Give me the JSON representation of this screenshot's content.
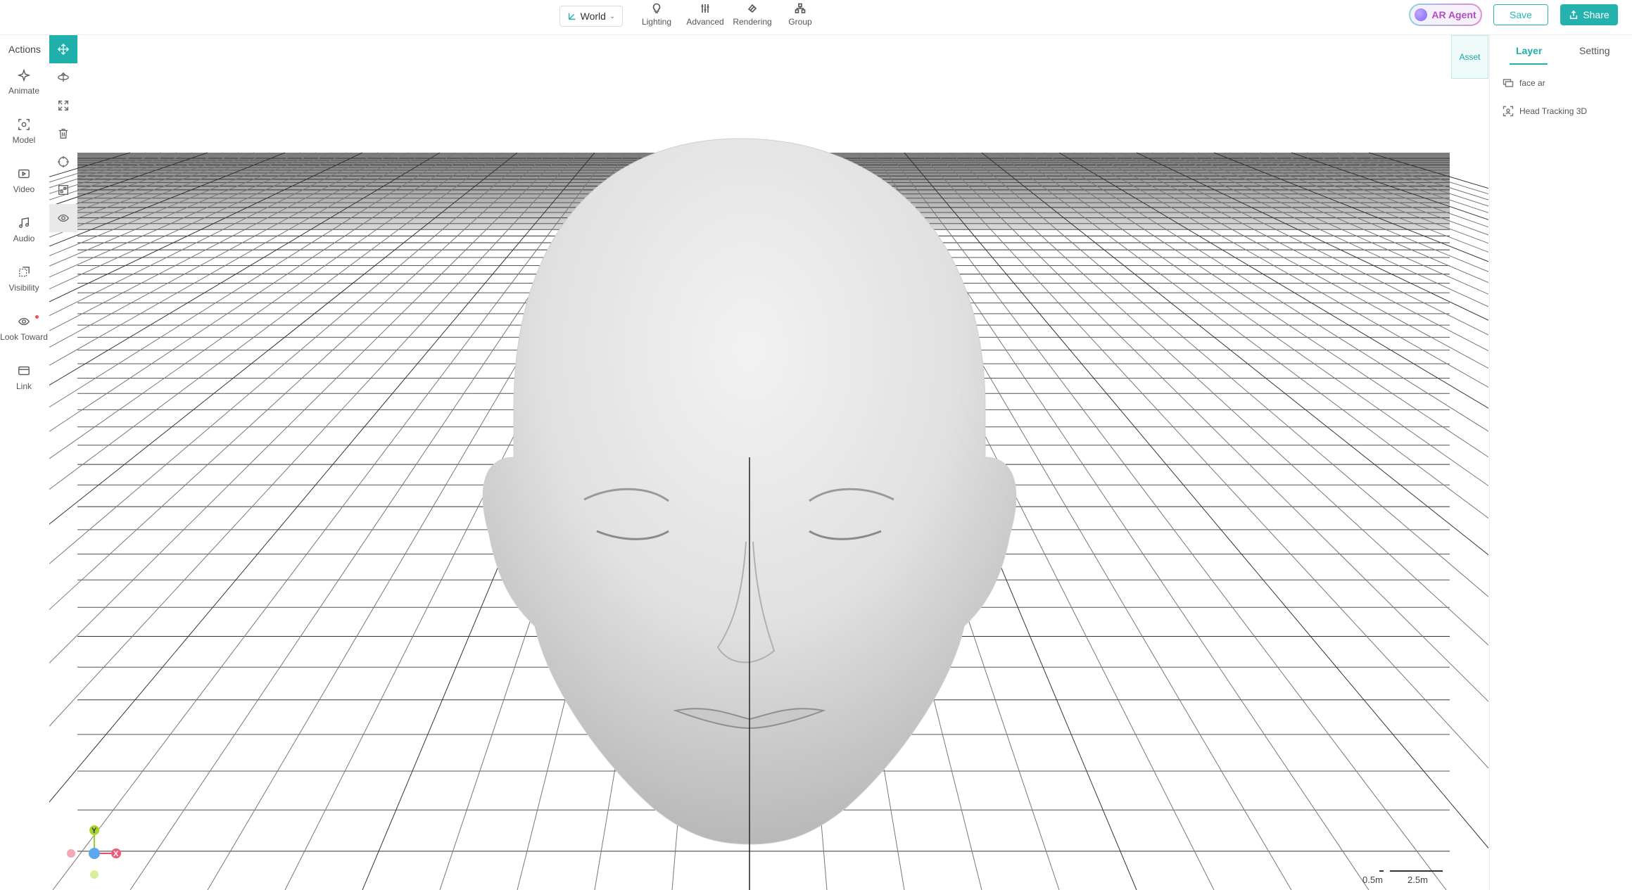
{
  "topbar": {
    "space_select": "World",
    "items": [
      {
        "label": "Lighting",
        "icon": "bulb-icon"
      },
      {
        "label": "Advanced",
        "icon": "sliders-icon"
      },
      {
        "label": "Rendering",
        "icon": "render-icon"
      },
      {
        "label": "Group",
        "icon": "group-icon"
      }
    ],
    "agent_label": "AR Agent",
    "save_label": "Save",
    "share_label": "Share"
  },
  "actions": {
    "title": "Actions",
    "items": [
      {
        "label": "Animate",
        "icon": "sparkle-icon"
      },
      {
        "label": "Model",
        "icon": "model-icon"
      },
      {
        "label": "Video",
        "icon": "video-icon"
      },
      {
        "label": "Audio",
        "icon": "music-icon"
      },
      {
        "label": "Visibility",
        "icon": "visibility-icon"
      },
      {
        "label": "Look Toward",
        "icon": "look-icon",
        "has_notification": true
      },
      {
        "label": "Link",
        "icon": "link-icon"
      }
    ]
  },
  "tools": [
    "move-icon",
    "rotate-icon",
    "scale-icon",
    "delete-icon",
    "focus-icon",
    "frame-icon",
    "eye-icon"
  ],
  "asset_tab": "Asset",
  "panel": {
    "tabs": [
      "Layer",
      "Setting"
    ],
    "active_tab": "Layer",
    "layers": [
      {
        "label": "face ar",
        "icon": "screen-icon"
      },
      {
        "label": "Head Tracking 3D",
        "icon": "tracking-icon"
      }
    ]
  },
  "viewport": {
    "scale_small": "0.5m",
    "scale_large": "2.5m",
    "axis_y": "Y",
    "axis_x": "X"
  },
  "colors": {
    "accent": "#1fb0ac",
    "agent_text": "#b04fc0"
  }
}
